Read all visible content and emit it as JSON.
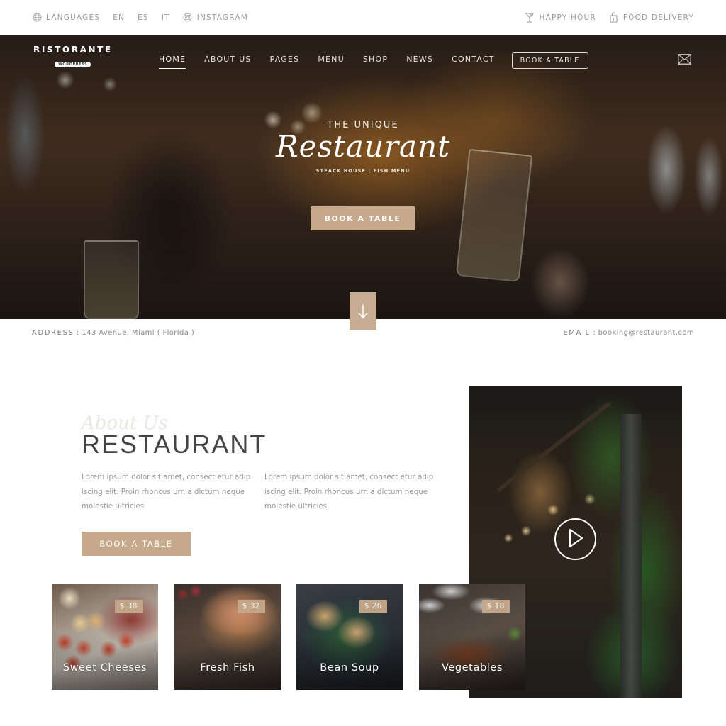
{
  "topbar": {
    "languages_label": "LANGUAGES",
    "languages": [
      "EN",
      "ES",
      "IT"
    ],
    "instagram_label": "INSTAGRAM",
    "happy_hour_label": "HAPPY HOUR",
    "food_delivery_label": "FOOD DELIVERY"
  },
  "logo": {
    "name": "RISTORANTE",
    "sub": "WORDPRESS"
  },
  "nav": {
    "items": [
      {
        "label": "HOME",
        "active": true
      },
      {
        "label": "ABOUT US"
      },
      {
        "label": "PAGES"
      },
      {
        "label": "MENU"
      },
      {
        "label": "SHOP"
      },
      {
        "label": "NEWS"
      },
      {
        "label": "CONTACT"
      }
    ],
    "book_label": "BOOK A TABLE"
  },
  "hero": {
    "pretitle": "THE UNIQUE",
    "title": "Restaurant",
    "tagline": "STEACK HOUSE | FISH MENU",
    "button_label": "BOOK A TABLE"
  },
  "info": {
    "address_label": "ADDRESS",
    "address_value": "143 Avenue, Miami ( Florida )",
    "email_label": "EMAIL",
    "email_value": "booking@restaurant.com"
  },
  "about": {
    "script": "About Us",
    "title": "RESTAURANT",
    "col1": "Lorem ipsum dolor sit amet, consect etur adip iscing elit. Proin rhoncus urn a dictum neque molestie ultricies.",
    "col2": "Lorem ipsum dolor sit amet, consect etur adip iscing elit. Proin rhoncus urn a dictum neque molestie ultricies.",
    "button_label": "BOOK A TABLE"
  },
  "dishes": [
    {
      "name": "Sweet Cheeses",
      "price": "$ 38"
    },
    {
      "name": "Fresh Fish",
      "price": "$ 32"
    },
    {
      "name": "Bean Soup",
      "price": "$ 26"
    },
    {
      "name": "Vegetables",
      "price": "$ 18"
    }
  ],
  "colors": {
    "accent": "#c6a98a",
    "heading": "#444444",
    "text": "#999999"
  }
}
